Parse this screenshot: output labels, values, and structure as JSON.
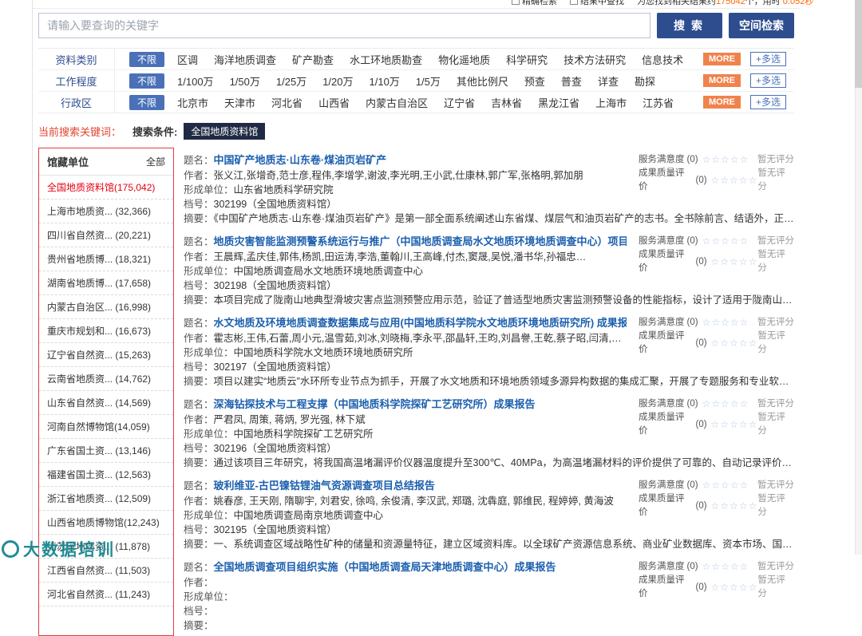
{
  "topbar": {
    "checkbox1": "精确检索",
    "checkbox2": "结果中查找",
    "result_prefix": "为您找到相关结果约",
    "result_count": "175042",
    "result_mid": "个，用时 ",
    "result_time": "0.052秒"
  },
  "search": {
    "placeholder": "请输入要查询的关键字",
    "search_button": "搜索",
    "spatial_button": "空间检索"
  },
  "filters": {
    "unlimited": "不限",
    "more_label": "MORE",
    "multi_label": "+多选",
    "rows": [
      {
        "label": "资料类别",
        "options": [
          "区调",
          "海洋地质调查",
          "矿产勘查",
          "水工环地质勘查",
          "物化遥地质",
          "科学研究",
          "技术方法研究",
          "信息技术"
        ]
      },
      {
        "label": "工作程度",
        "options": [
          "1/100万",
          "1/50万",
          "1/25万",
          "1/20万",
          "1/10万",
          "1/5万",
          "其他比例尺",
          "预查",
          "普查",
          "详查",
          "勘探"
        ]
      },
      {
        "label": "行政区",
        "options": [
          "北京市",
          "天津市",
          "河北省",
          "山西省",
          "内蒙古自治区",
          "辽宁省",
          "吉林省",
          "黑龙江省",
          "上海市",
          "江苏省"
        ]
      }
    ]
  },
  "keyword_bar": {
    "label": "当前搜索关键词：",
    "condition": "搜索条件:",
    "tag": "全国地质资料馆"
  },
  "sidebar": {
    "title": "馆藏单位",
    "all": "全部",
    "items": [
      "全国地质资料馆(175,042)",
      "上海市地质资... (32,366)",
      "四川省自然资... (20,221)",
      "贵州省地质博... (18,321)",
      "湖南省地质博... (17,658)",
      "内蒙古自治区... (16,998)",
      "重庆市规划和... (16,673)",
      "辽宁省自然资... (15,263)",
      "云南省地质资... (14,762)",
      "山东省自然资... (14,569)",
      "河南自然博物馆(14,059)",
      "广东省国土资... (13,146)",
      "福建省国土资... (12,563)",
      "浙江省地质资... (12,509)",
      "山西省地质博物馆(12,243)",
      "江苏省地质资... (11,878)",
      "江西省自然资... (11,503)",
      "河北省自然资... (11,243)"
    ]
  },
  "labels": {
    "title": "题名：",
    "author": "作者：",
    "unit": "形成单位：",
    "file_no": "档号：",
    "abstract": "摘要："
  },
  "rating": {
    "service_label": "服务满意度",
    "quality_label": "成果质量评价",
    "count": "(0)",
    "stars": "☆☆☆☆☆",
    "none": "暂无评分"
  },
  "results": [
    {
      "title": "中国矿产地质志·山东卷·煤油页岩矿产",
      "authors": "张义江,张增奇,范士彦,程伟,李增学,谢波,李光明,王小武,仕康林,郭广军,张格明,郭加朋",
      "unit": "山东省地质科学研究院",
      "file_no": "302199（全国地质资料馆）",
      "abstract": "《中国矿产地质志·山东卷·煤油页岩矿产》是第一部全面系统阐述山东省煤、煤层气和油页岩矿产的志书。全书除前言、结语外，正文分五篇38章，…"
    },
    {
      "title": "地质灾害智能监测预警系统运行与推广（中国地质调查局水文地质环境地质调查中心）项目成果报告",
      "authors": "王晨辉,孟庆佳,郭伟,杨凯,田运涛,李浩,董翰川,王高峰,付杰,窦晟,吴悦,潘书华,孙福忠…",
      "unit": "中国地质调查局水文地质环境地质调查中心",
      "file_no": "302198（全国地质资料馆）",
      "abstract": "本项目完成了陇南山地典型滑坡灾害点监测预警应用示范，验证了普适型地质灾害监测预警设备的性能指标，设计了适用于陇南山地的滑坡监测预警…"
    },
    {
      "title": "水文地质及环境地质调查数据集成与应用(中国地质科学院水文地质环境地质研究所) 成果报告",
      "authors": "霍志彬,王伟,石蕾,周小元,温雪茹,刘冰,刘晓梅,李永平,邵晶轩,王昀,刘昌譽,王乾,蔡子昭,闫清,表丹,朱吉祥,陆玫,…",
      "unit": "中国地质科学院水文地质环境地质研究所",
      "file_no": "302197（全国地质资料馆）",
      "abstract": "项目以建实“地质云”水环所专业节点为抓手，开展了水文地质和环境地质领域多源异构数据的集成汇聚，开展了专题服务和专业软件系统的集成和…"
    },
    {
      "title": "深海钻探技术与工程支撑（中国地质科学院探矿工艺研究所）成果报告",
      "authors": "严君凤, 周策, 蒋炳, 罗光强, 林下斌",
      "unit": "中国地质科学院探矿工艺研究所",
      "file_no": "302196（全国地质资料馆）",
      "abstract": "通过该项目三年研究，将我国高温堵漏评价仪器温度提升至300℃、40MPa，为高温堵漏材料的评价提供了可靠的、自动记录评价仪器；研制的抗高…"
    },
    {
      "title": "玻利维亚-古巴镍钴锂油气资源调查项目总结报告",
      "authors": "姚春彦, 王天刚, 隋聊宇, 刘君安, 徐鸣, 余俊清, 李汉武, 郑璐, 沈犇庭, 郭维民, 程婷婷, 黄海波",
      "unit": "中国地质调查局南京地质调查中心",
      "file_no": "302195（全国地质资料馆）",
      "abstract": "一、系统调查区域战略性矿种的储量和资源量特征，建立区域资料库。以全球矿产资源信息系统、商业矿业数据库、资本市场、国外政府统计矿业数…"
    },
    {
      "title": "全国地质调查项目组织实施（中国地质调查局天津地质调查中心）成果报告",
      "authors": "",
      "unit": "",
      "file_no": "",
      "abstract": ""
    }
  ],
  "watermark": {
    "text": "大数据培训"
  }
}
